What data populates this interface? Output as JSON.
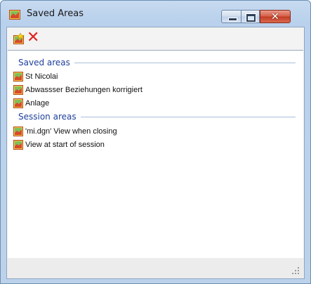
{
  "window": {
    "title": "Saved Areas"
  },
  "toolbar": {
    "add_icon": "save-area-icon",
    "delete_icon": "delete-icon"
  },
  "groups": [
    {
      "title": "Saved areas",
      "items": [
        "St Nicolai",
        "Abwassser Beziehungen korrigiert",
        "Anlage"
      ]
    },
    {
      "title": "Session areas",
      "items": [
        "'mi.dgn' View when closing",
        "View at start of session"
      ]
    }
  ],
  "colors": {
    "group_header": "#1e3f9a",
    "delete": "#e02020",
    "close_button": "#c13b24"
  }
}
